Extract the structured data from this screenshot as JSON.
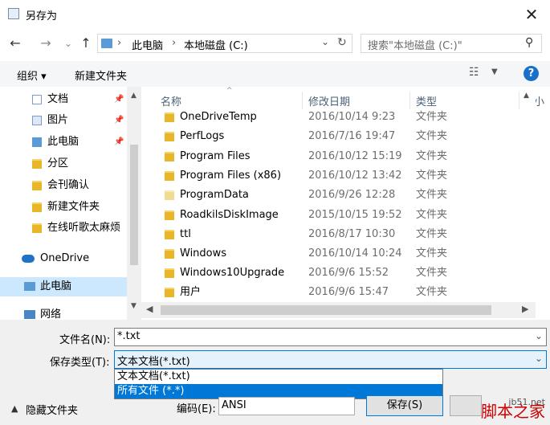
{
  "window": {
    "title": "另存为",
    "close_glyph": "✕"
  },
  "nav": {
    "back": "←",
    "forward": "→",
    "recent": "⌄",
    "up": "↑",
    "breadcrumb": [
      "此电脑",
      "本地磁盘 (C:)"
    ],
    "breadcrumb_sep": "›",
    "search_placeholder": "搜索\"本地磁盘 (C:)\""
  },
  "toolbar": {
    "organize": "组织 ▾",
    "new_folder": "新建文件夹"
  },
  "sidebar": {
    "items": [
      {
        "label": "文档",
        "icon": "documents-icon",
        "pinned": true
      },
      {
        "label": "图片",
        "icon": "pictures-icon",
        "pinned": true
      },
      {
        "label": "此电脑",
        "icon": "computer-icon",
        "pinned": true
      },
      {
        "label": "分区",
        "icon": "folder-icon",
        "pinned": false
      },
      {
        "label": "会刊确认",
        "icon": "folder-icon",
        "pinned": false
      },
      {
        "label": "新建文件夹",
        "icon": "folder-icon",
        "pinned": false
      },
      {
        "label": "在线听歌太麻烦",
        "icon": "folder-icon",
        "pinned": false
      },
      {
        "label": "OneDrive",
        "icon": "onedrive-icon",
        "pinned": false
      },
      {
        "label": "此电脑",
        "icon": "computer-icon",
        "pinned": false
      },
      {
        "label": "网络",
        "icon": "network-icon",
        "pinned": false
      }
    ]
  },
  "columns": {
    "name": "名称",
    "modified": "修改日期",
    "type": "类型",
    "size": "大小"
  },
  "files": [
    {
      "name": "OneDriveTemp",
      "modified": "2016/10/14 9:23",
      "type": "文件夹"
    },
    {
      "name": "PerfLogs",
      "modified": "2016/7/16 19:47",
      "type": "文件夹"
    },
    {
      "name": "Program Files",
      "modified": "2016/10/12 15:19",
      "type": "文件夹"
    },
    {
      "name": "Program Files (x86)",
      "modified": "2016/10/12 13:42",
      "type": "文件夹"
    },
    {
      "name": "ProgramData",
      "modified": "2016/9/26 12:28",
      "type": "文件夹"
    },
    {
      "name": "RoadkilsDiskImage",
      "modified": "2015/10/15 19:52",
      "type": "文件夹"
    },
    {
      "name": "ttl",
      "modified": "2016/8/17 10:30",
      "type": "文件夹"
    },
    {
      "name": "Windows",
      "modified": "2016/10/14 10:24",
      "type": "文件夹"
    },
    {
      "name": "Windows10Upgrade",
      "modified": "2016/9/6 15:52",
      "type": "文件夹"
    },
    {
      "name": "用户",
      "modified": "2016/9/6 15:47",
      "type": "文件夹"
    }
  ],
  "form": {
    "filename_label": "文件名(N):",
    "filename_value": "*.txt",
    "filetype_label": "保存类型(T):",
    "filetype_value": "文本文档(*.txt)",
    "filetype_options": [
      "文本文档(*.txt)",
      "所有文件 (*.*)"
    ],
    "hide_folders": "隐藏文件夹",
    "encoding_label": "编码(E):",
    "encoding_value": "ANSI",
    "save": "保存(S)"
  },
  "watermark": {
    "site": "jb51.net",
    "name": "脚本之家"
  },
  "colors": {
    "accent": "#0078d7",
    "selection": "#cce8ff",
    "folder": "#e8b628"
  }
}
